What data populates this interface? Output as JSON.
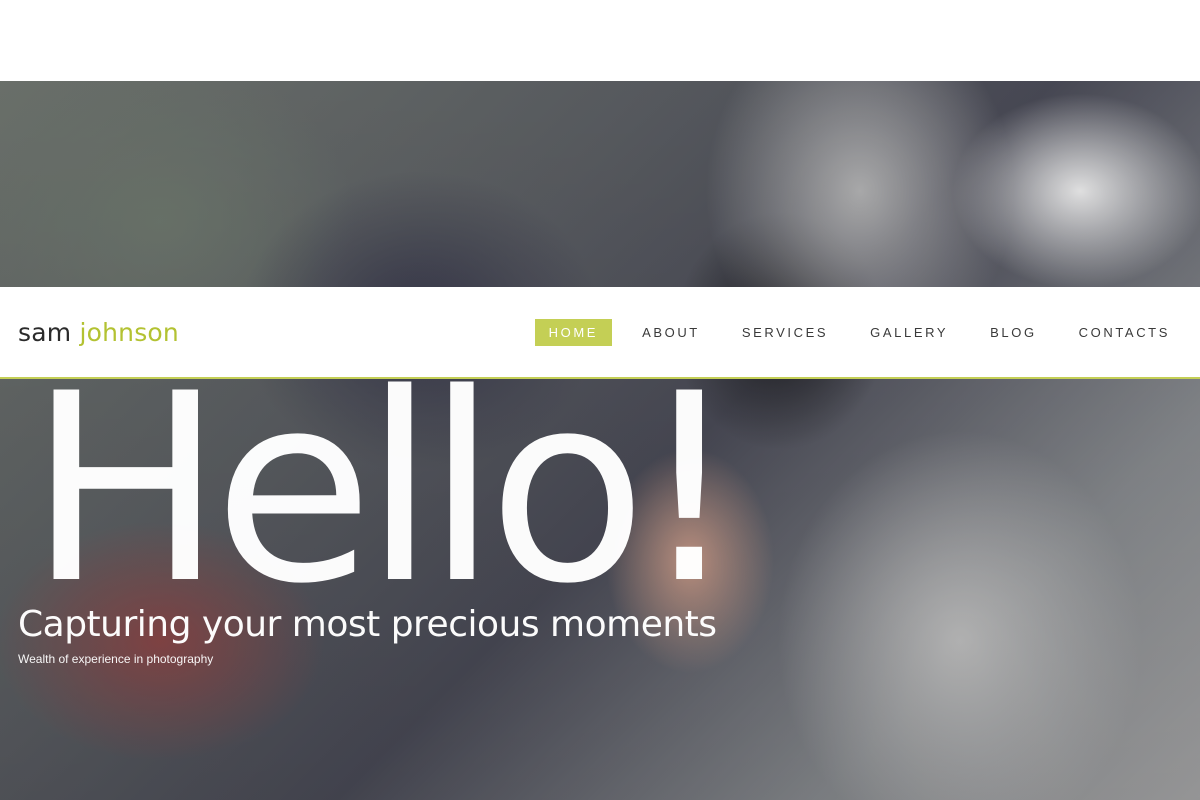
{
  "brand": {
    "first": "sam",
    "last": "johnson"
  },
  "nav": {
    "items": [
      {
        "label": "HOME",
        "active": true
      },
      {
        "label": "ABOUT",
        "active": false
      },
      {
        "label": "SERVICES",
        "active": false
      },
      {
        "label": "GALLERY",
        "active": false
      },
      {
        "label": "BLOG",
        "active": false
      },
      {
        "label": "CONTACTS",
        "active": false
      }
    ]
  },
  "hero": {
    "headline": "Hello!",
    "tagline": "Capturing your most precious moments",
    "subline": "Wealth of experience in photography"
  },
  "colors": {
    "accent": "#c4cf55",
    "text_dark": "#2b2b2b",
    "white": "#ffffff"
  }
}
